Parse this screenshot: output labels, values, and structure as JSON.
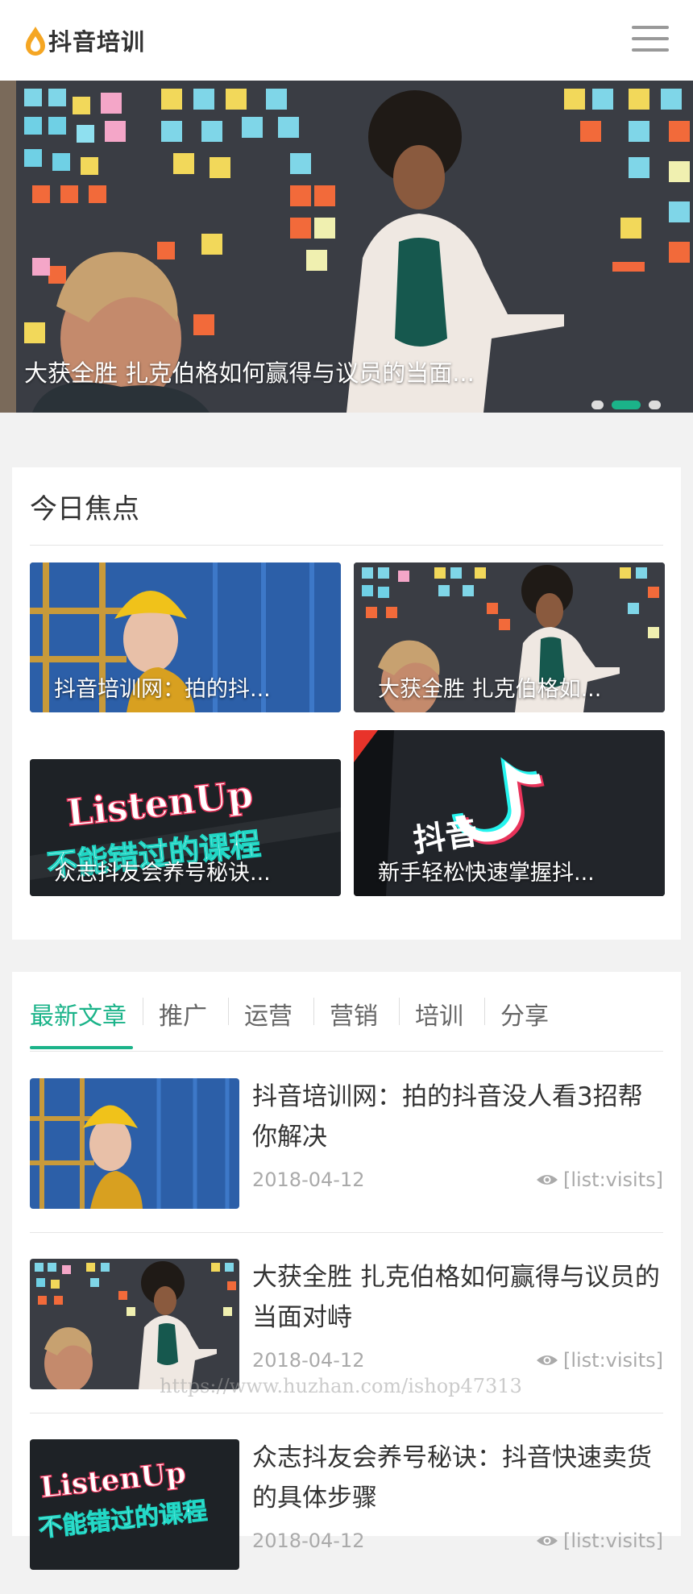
{
  "header": {
    "logo_text": "抖音培训"
  },
  "banner": {
    "caption": "大获全胜 扎克伯格如何赢得与议员的当面...",
    "slides": 3,
    "active_slide": 2
  },
  "focus": {
    "title": "今日焦点",
    "cards": [
      {
        "caption": "抖音培训网：拍的抖..."
      },
      {
        "caption": "大获全胜 扎克伯格如..."
      },
      {
        "caption": "众志抖友会养号秘诀..."
      },
      {
        "caption": "新手轻松快速掌握抖..."
      }
    ],
    "listen_up": "ListenUp",
    "course_text": "不能错过的课程",
    "douyin_text": "抖音"
  },
  "tabs": [
    "最新文章",
    "推广",
    "运营",
    "营销",
    "培训",
    "分享"
  ],
  "articles": [
    {
      "title": "抖音培训网：拍的抖音没人看3招帮你解决",
      "date": "2018-04-12",
      "visits": "[list:visits]"
    },
    {
      "title": "大获全胜 扎克伯格如何赢得与议员的当面对峙",
      "date": "2018-04-12",
      "visits": "[list:visits]"
    },
    {
      "title": "众志抖友会养号秘诀：抖音快速卖货的具体步骤",
      "date": "2018-04-12",
      "visits": "[list:visits]"
    }
  ],
  "watermark": "https://www.huzhan.com/ishop47313",
  "colors": {
    "accent": "#1bb389",
    "logo": "#f5a623"
  }
}
